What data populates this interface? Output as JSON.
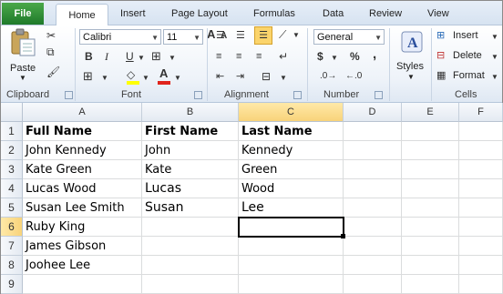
{
  "tabs": [
    "File",
    "Home",
    "Insert",
    "Page Layout",
    "Formulas",
    "Data",
    "Review",
    "View"
  ],
  "ribbon": {
    "clipboard": {
      "label": "Clipboard",
      "paste": "Paste"
    },
    "font": {
      "label": "Font",
      "name": "Calibri",
      "size": "11",
      "bold": "B",
      "italic": "I",
      "underline": "U",
      "grow": "A",
      "shrink": "A"
    },
    "alignment": {
      "label": "Alignment"
    },
    "number": {
      "label": "Number",
      "format": "General",
      "currency": "$",
      "percent": "%",
      "comma": ","
    },
    "styles": {
      "label": "Styles"
    },
    "cells": {
      "label": "Cells",
      "insert": "Insert",
      "delete": "Delete",
      "format": "Format"
    }
  },
  "grid": {
    "columns": [
      "A",
      "B",
      "C",
      "D",
      "E",
      "F"
    ],
    "selected_column": "C",
    "selected_row": "6",
    "rows": [
      {
        "num": "1",
        "cells": [
          "Full Name",
          "First Name",
          "Last Name",
          "",
          "",
          ""
        ]
      },
      {
        "num": "2",
        "cells": [
          "John Kennedy",
          "John",
          "Kennedy",
          "",
          "",
          ""
        ]
      },
      {
        "num": "3",
        "cells": [
          "Kate Green",
          "Kate",
          "Green",
          "",
          "",
          ""
        ]
      },
      {
        "num": "4",
        "cells": [
          "Lucas Wood",
          "Lucas",
          "Wood",
          "",
          "",
          ""
        ]
      },
      {
        "num": "5",
        "cells": [
          "Susan Lee Smith",
          "Susan",
          "Lee",
          "",
          "",
          ""
        ]
      },
      {
        "num": "6",
        "cells": [
          "Ruby King",
          "",
          "",
          "",
          "",
          ""
        ]
      },
      {
        "num": "7",
        "cells": [
          "James Gibson",
          "",
          "",
          "",
          "",
          ""
        ]
      },
      {
        "num": "8",
        "cells": [
          "Joohee Lee",
          "",
          "",
          "",
          "",
          ""
        ]
      },
      {
        "num": "9",
        "cells": [
          "",
          "",
          "",
          "",
          "",
          ""
        ]
      }
    ]
  }
}
